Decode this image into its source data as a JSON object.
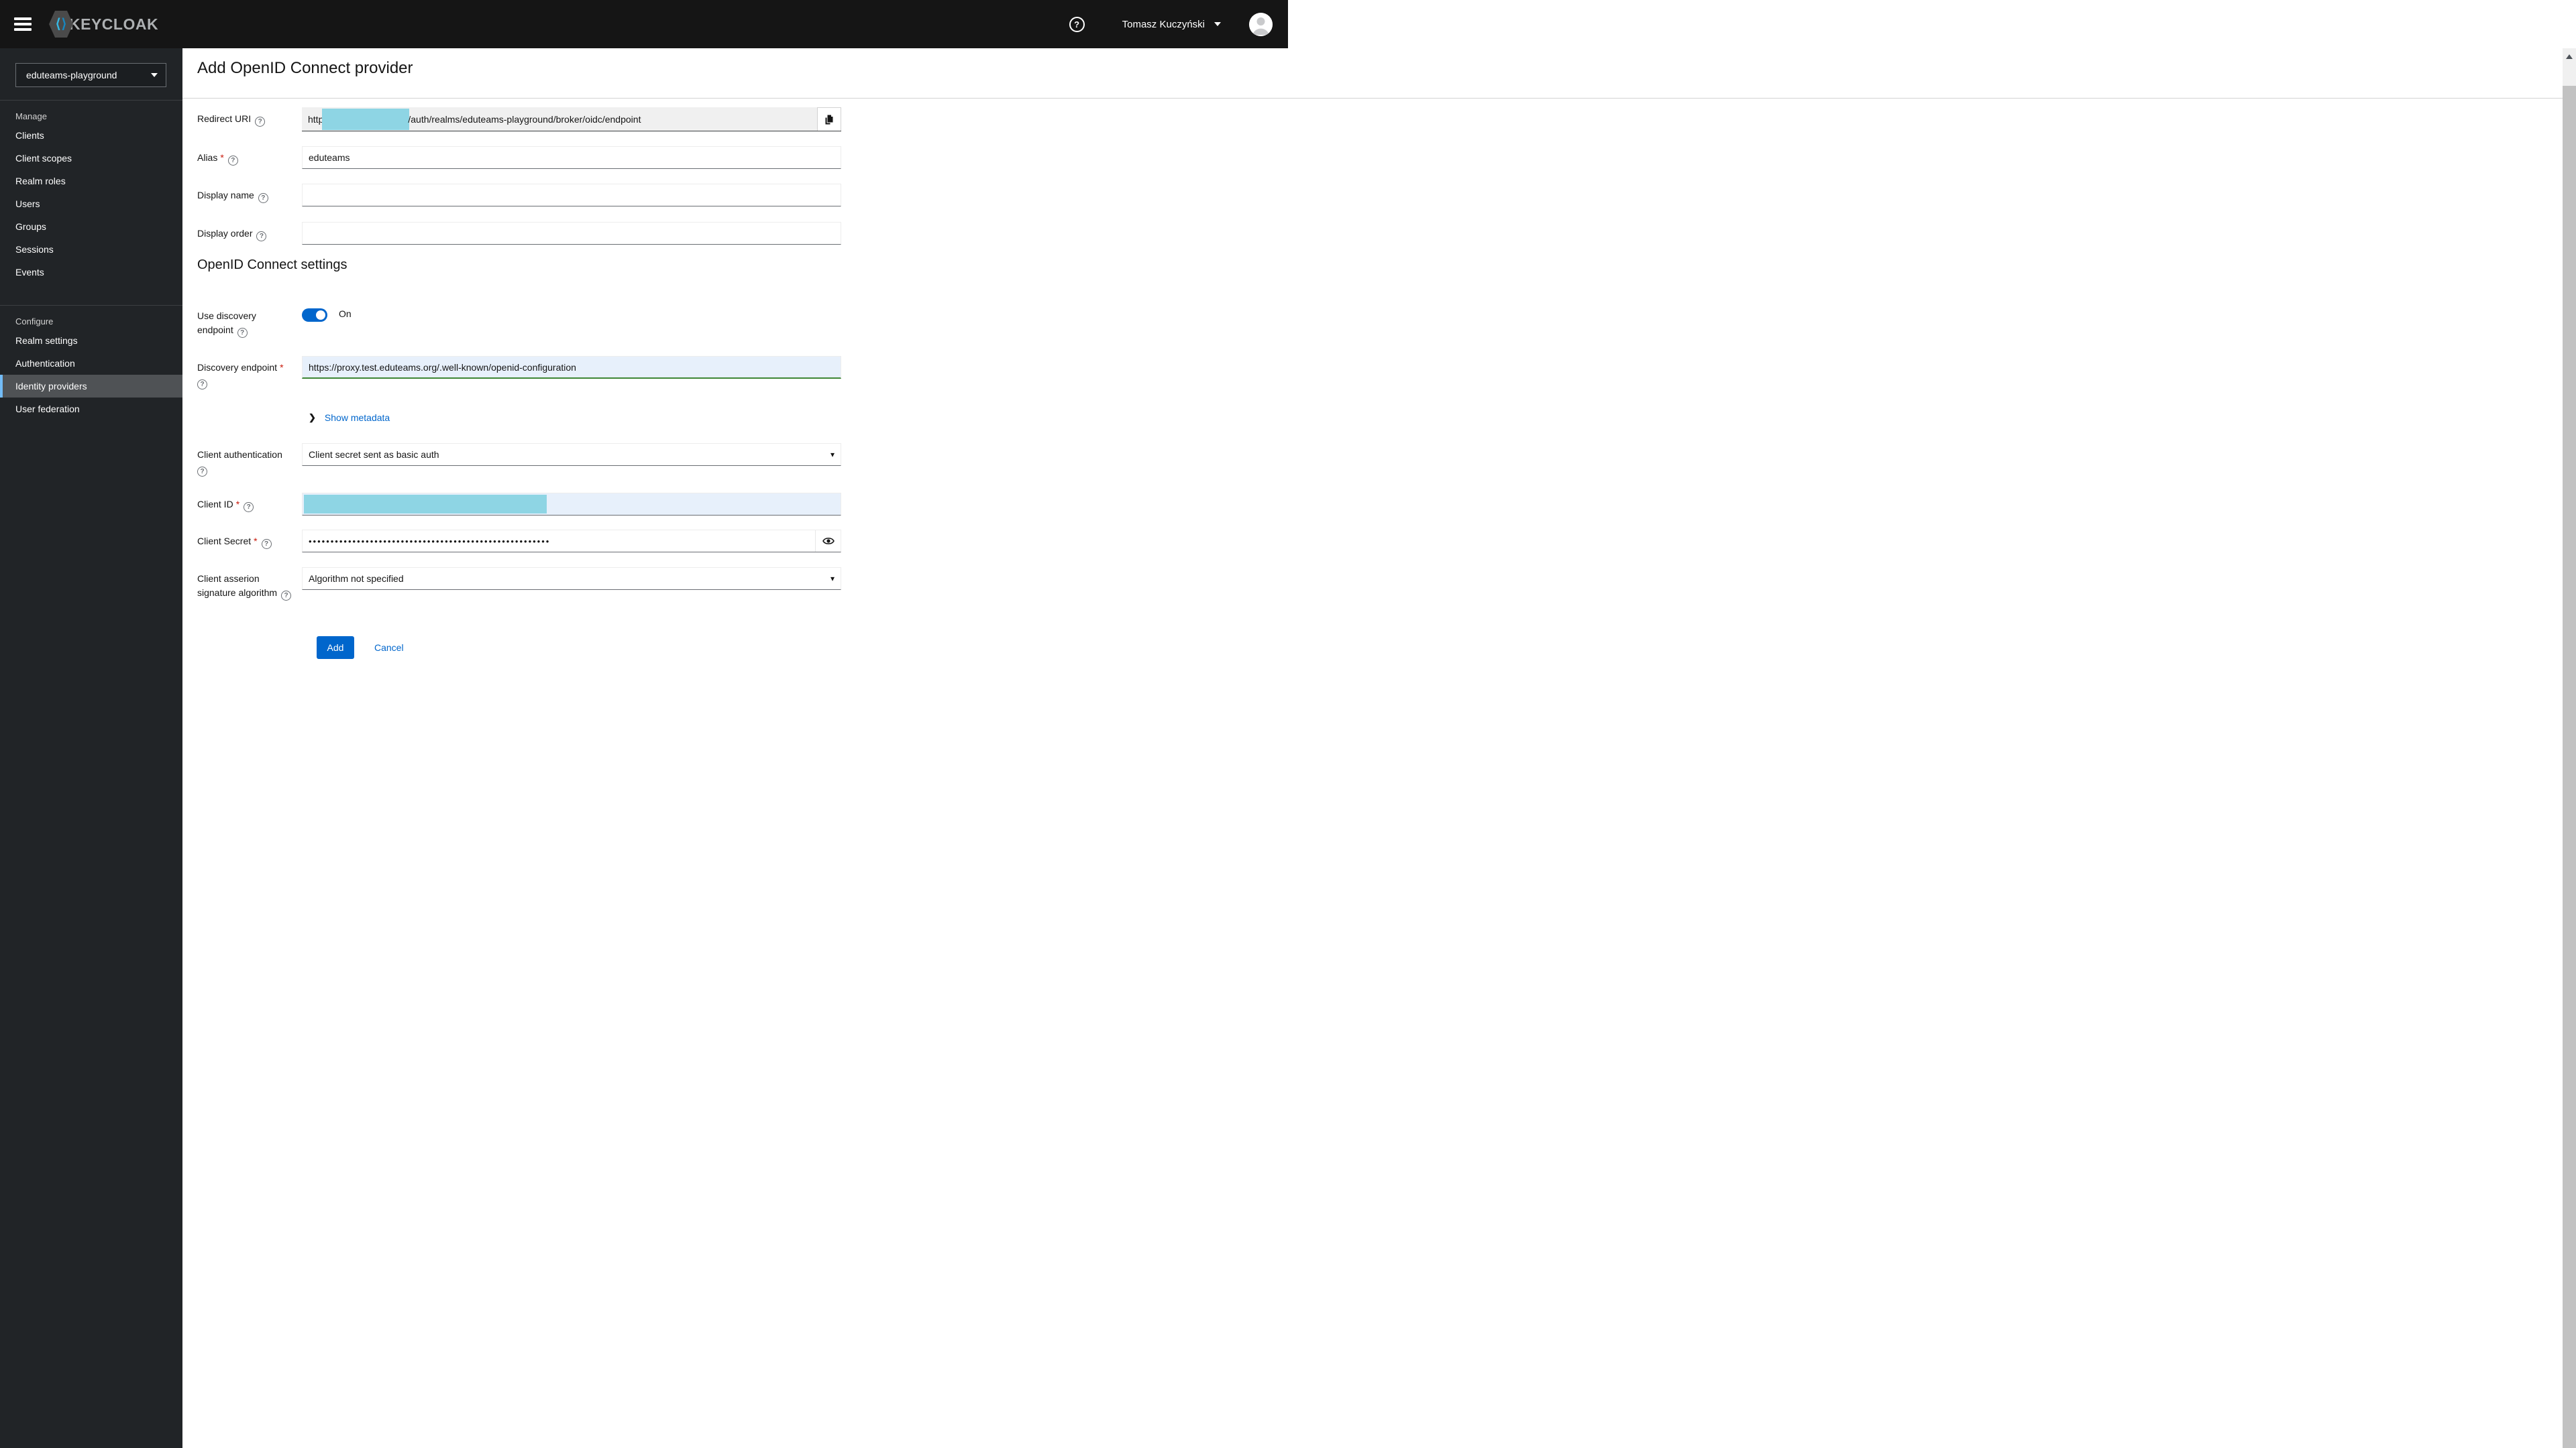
{
  "ui": {
    "required_marker": "*",
    "help_glyph": "?",
    "caret": "▾",
    "chevron": "❯"
  },
  "colors": {
    "masthead_bg": "#151515",
    "sidebar_bg": "#212427",
    "selected_item_bg": "#4f5255",
    "selected_item_border": "#73bcf7",
    "accent_blue": "#0066cc",
    "success_green": "#3e8635",
    "redaction_cyan": "#8ed5e4",
    "autofill_blue": "#e7f0fb"
  },
  "masthead": {
    "brand_text": "KEYCLOAK",
    "user_name": "Tomasz Kuczyński"
  },
  "sidebar": {
    "realm_selector": {
      "value": "eduteams-playground"
    },
    "sections": [
      {
        "label": "Manage",
        "items": [
          "Clients",
          "Client scopes",
          "Realm roles",
          "Users",
          "Groups",
          "Sessions",
          "Events"
        ]
      },
      {
        "label": "Configure",
        "items": [
          "Realm settings",
          "Authentication",
          "Identity providers",
          "User federation"
        ],
        "selected_item": "Identity providers"
      }
    ]
  },
  "page": {
    "title": "Add OpenID Connect provider",
    "section_heading": "OpenID Connect settings",
    "fields": {
      "redirect_uri": {
        "label": "Redirect URI",
        "value_prefix": "http",
        "value_suffix": "/auth/realms/eduteams-playground/broker/oidc/endpoint"
      },
      "alias": {
        "label": "Alias",
        "value": "eduteams"
      },
      "display_name": {
        "label": "Display name",
        "value": ""
      },
      "display_order": {
        "label": "Display order",
        "value": ""
      },
      "use_discovery": {
        "label_line1": "Use discovery",
        "label_line2": "endpoint",
        "state_label": "On"
      },
      "discovery_endpoint": {
        "label": "Discovery endpoint",
        "value": "https://proxy.test.eduteams.org/.well-known/openid-configuration"
      },
      "show_metadata": {
        "label": "Show metadata"
      },
      "client_authentication": {
        "label": "Client authentication",
        "value": "Client secret sent as basic auth"
      },
      "client_id": {
        "label": "Client ID",
        "value": ""
      },
      "client_secret": {
        "label": "Client Secret",
        "masked_value": "•••••••••••••••••••••••••••••••••••••••••••••••••••••••"
      },
      "client_assertion_alg": {
        "label_line1": "Client asserion",
        "label_line2": "signature algorithm",
        "value": "Algorithm not specified"
      }
    },
    "actions": {
      "add": "Add",
      "cancel": "Cancel"
    }
  }
}
